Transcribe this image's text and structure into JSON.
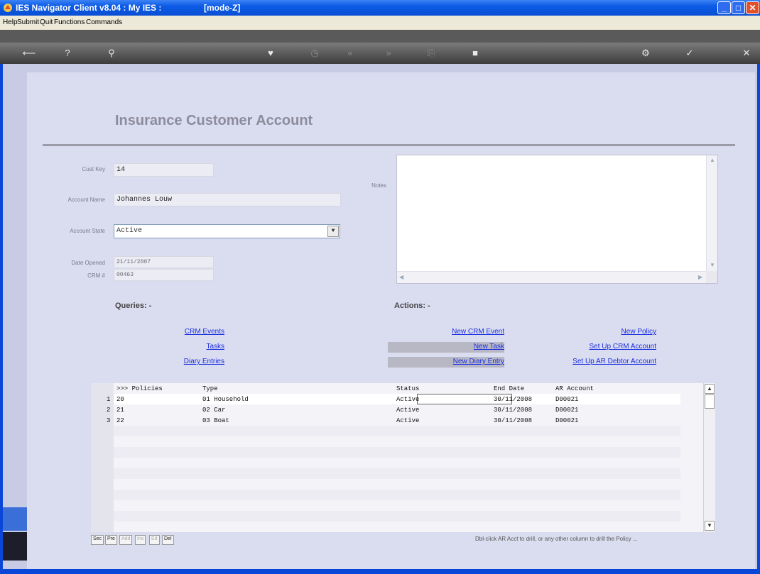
{
  "window": {
    "title": "IES Navigator Client v8.04 : My IES :",
    "mode": "[mode-Z]"
  },
  "menu": [
    "Help",
    "Submit",
    "Quit",
    "Functions",
    "Commands"
  ],
  "page": {
    "title": "Insurance Customer Account"
  },
  "form": {
    "cust_key_label": "Cust Key",
    "cust_key": "14",
    "account_name_label": "Account Name",
    "account_name": "Johannes Louw",
    "account_state_label": "Account State",
    "account_state": "Active",
    "date_opened_label": "Date Opened",
    "date_opened": "21/11/2007",
    "crm_label": "CRM #",
    "crm": "00463",
    "notes_label": "Notes"
  },
  "queries": {
    "title": "Queries: -",
    "items": [
      "CRM Events",
      "Tasks",
      "Diary Entries"
    ]
  },
  "actions": {
    "title": "Actions: -",
    "col1": [
      "New CRM Event",
      "New Task",
      "New Diary Entry"
    ],
    "col2": [
      "New Policy",
      "Set Up CRM Account",
      "Set Up AR Debtor Account"
    ]
  },
  "grid": {
    "headers": [
      ">>> Policies",
      "Type",
      "Status",
      "End Date",
      "AR Account"
    ],
    "rows": [
      {
        "n": "1",
        "policy": "20",
        "type": "01 Household",
        "status": "Active",
        "end": "30/11/2008",
        "ar": "D00021"
      },
      {
        "n": "2",
        "policy": "21",
        "type": "02 Car",
        "status": "Active",
        "end": "30/11/2008",
        "ar": "D00021"
      },
      {
        "n": "3",
        "policy": "22",
        "type": "03 Boat",
        "status": "Active",
        "end": "30/11/2008",
        "ar": "D00021"
      }
    ]
  },
  "nav_buttons": [
    "Sec",
    "Pre",
    "Add",
    "Ins",
    "Ed",
    "Del"
  ],
  "hint": "Dbl-click AR Acct to drill, or any other column to drill the Policy ..."
}
